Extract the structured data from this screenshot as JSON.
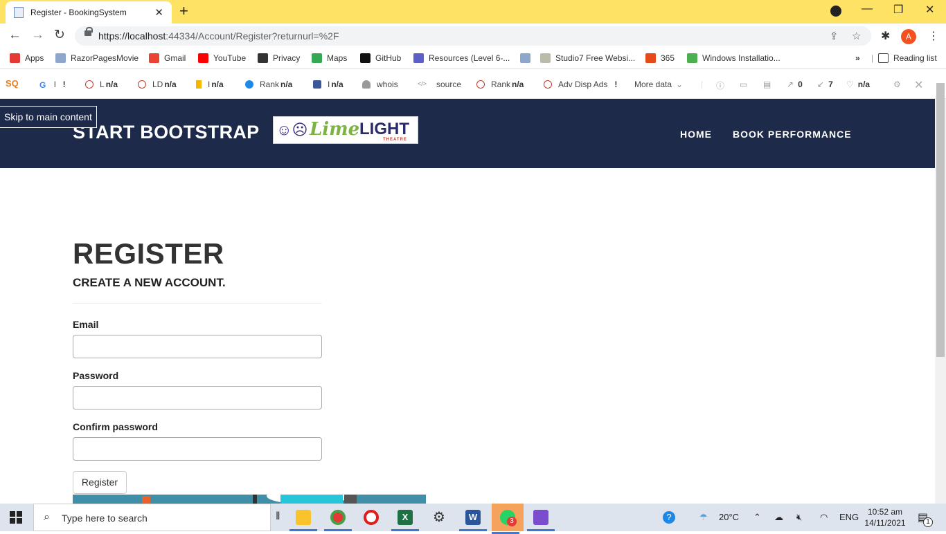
{
  "browser": {
    "tab_title": "Register - BookingSystem",
    "url_host": "https://localhost",
    "url_rest": ":44334/Account/Register?returnurl=%2F",
    "avatar_letter": "A"
  },
  "bookmarks": [
    {
      "label": "Apps",
      "icon": "apps-grid-icon",
      "color": "#e53935"
    },
    {
      "label": "RazorPagesMovie",
      "icon": "page-icon",
      "color": "#8fa6cc"
    },
    {
      "label": "Gmail",
      "icon": "gmail-icon",
      "color": "#ea4335"
    },
    {
      "label": "YouTube",
      "icon": "youtube-icon",
      "color": "#ff0000"
    },
    {
      "label": "Privacy",
      "icon": "globe-icon",
      "color": "#333333"
    },
    {
      "label": "Maps",
      "icon": "maps-pin-icon",
      "color": "#34a853"
    },
    {
      "label": "GitHub",
      "icon": "github-icon",
      "color": "#111111"
    },
    {
      "label": "Resources (Level 6-...",
      "icon": "teams-icon",
      "color": "#5b5fc7"
    },
    {
      "label": "",
      "icon": "page-icon",
      "color": "#8fa6cc"
    },
    {
      "label": "Studio7 Free Websi...",
      "icon": "studio-icon",
      "color": "#bba"
    },
    {
      "label": "365",
      "icon": "office-icon",
      "color": "#e64a19"
    },
    {
      "label": "Windows Installatio...",
      "icon": "windows-icon",
      "color": "#4caf50"
    }
  ],
  "bookmarks_overflow": "»",
  "reading_list": "Reading list",
  "seo_toolbar": {
    "items": [
      {
        "prefix": "l",
        "value": "!"
      },
      {
        "prefix": "L",
        "value": "n/a"
      },
      {
        "prefix": "LD",
        "value": "n/a"
      },
      {
        "prefix": "I",
        "value": "n/a"
      },
      {
        "prefix": "Rank",
        "value": "n/a"
      },
      {
        "prefix": "I",
        "value": "n/a"
      },
      {
        "prefix": "whois",
        "value": ""
      },
      {
        "prefix": "source",
        "value": ""
      },
      {
        "prefix": "Rank",
        "value": "n/a"
      },
      {
        "prefix": "Adv Disp Ads",
        "value": "!"
      }
    ],
    "more_data": "More data",
    "counts": {
      "links_out": "0",
      "links_in": "7",
      "health": "n/a"
    }
  },
  "site": {
    "skip_link": "Skip to main content",
    "brand": "START BOOTSTRAP",
    "logo": {
      "lime": "Lime",
      "light": "LIGHT",
      "theatre": "THEATRE"
    },
    "nav": [
      "HOME",
      "BOOK PERFORMANCE"
    ]
  },
  "form": {
    "heading": "REGISTER",
    "subheading": "CREATE A NEW ACCOUNT.",
    "email_label": "Email",
    "password_label": "Password",
    "confirm_label": "Confirm password",
    "email_value": "",
    "password_value": "",
    "confirm_value": "",
    "submit_label": "Register"
  },
  "taskbar": {
    "search_placeholder": "Type here to search",
    "weather": "20°C",
    "lang": "ENG",
    "time": "10:52 am",
    "date": "14/11/2021",
    "whatsapp_badge": "3",
    "notification_badge": "1"
  }
}
